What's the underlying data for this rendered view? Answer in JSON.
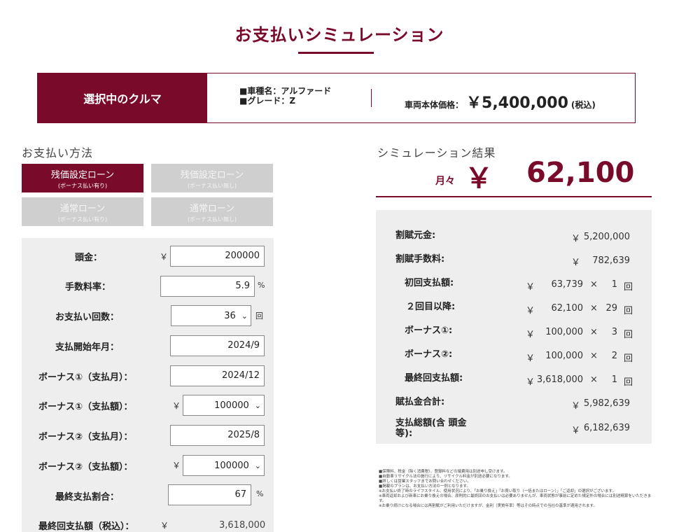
{
  "page": {
    "title": "お支払いシミュレーション"
  },
  "car": {
    "header": "選択中のクルマ",
    "model_line": "■車種名：アルファード",
    "grade_line": "■グレード：Z",
    "price_label": "車両本体価格：",
    "price_value": "￥5,400,000",
    "price_tax": "(税込)"
  },
  "payment_method": {
    "label": "お支払い方法",
    "options": [
      {
        "label": "残価設定ローン",
        "sub": "(ボーナス払い有り)",
        "active": true
      },
      {
        "label": "残価設定ローン",
        "sub": "(ボーナス払い無し)",
        "active": false
      },
      {
        "label": "通常ローン",
        "sub": "(ボーナス払い有り)",
        "active": false
      },
      {
        "label": "通常ローン",
        "sub": "(ボーナス払い無し)",
        "active": false
      }
    ]
  },
  "form": {
    "down_payment": {
      "label": "頭金：",
      "yen": "￥",
      "value": "200000"
    },
    "fee_rate": {
      "label": "手数料率：",
      "value": "5.9",
      "unit": "%"
    },
    "installments": {
      "label": "お支払い回数：",
      "value": "36",
      "unit": "回"
    },
    "start_month": {
      "label": "支払開始年月：",
      "value": "2024/9"
    },
    "bonus1_month": {
      "label": "ボーナス①（支払月）：",
      "value": "2024/12"
    },
    "bonus1_amount": {
      "label": "ボーナス①（支払額）：",
      "yen": "￥",
      "value": "100000"
    },
    "bonus2_month": {
      "label": "ボーナス②（支払月）：",
      "value": "2025/8"
    },
    "bonus2_amount": {
      "label": "ボーナス②（支払額）：",
      "yen": "￥",
      "value": "100000"
    },
    "final_ratio": {
      "label": "最終支払割合：",
      "value": "67",
      "unit": "%"
    },
    "final_amount": {
      "label": "最終回支払額（税込）：",
      "yen": "￥",
      "value": "3,618,000"
    }
  },
  "result": {
    "label": "シミュレーション結果",
    "monthly_label": "月々",
    "monthly_yen": "￥",
    "monthly_amount": "62,100",
    "rows": [
      {
        "label": "割賦元金:",
        "yen": "￥",
        "value": "5,200,000"
      },
      {
        "label": "割賦手数料:",
        "yen": "￥",
        "value": "782,639"
      },
      {
        "label": "初回支払額:",
        "yen": "￥",
        "value": "63,739",
        "x": "×",
        "count": "1",
        "unit": "回"
      },
      {
        "label": "２回目以降:",
        "yen": "￥",
        "value": "62,100",
        "x": "×",
        "count": "29",
        "unit": "回"
      },
      {
        "label": "ボーナス①:",
        "yen": "￥",
        "value": "100,000",
        "x": "×",
        "count": "3",
        "unit": "回"
      },
      {
        "label": "ボーナス②:",
        "yen": "￥",
        "value": "100,000",
        "x": "×",
        "count": "2",
        "unit": "回"
      },
      {
        "label": "最終回支払額:",
        "yen": "￥",
        "value": "3,618,000",
        "x": "×",
        "count": "1",
        "unit": "回"
      },
      {
        "label": "賦払金合計:",
        "yen": "￥",
        "value": "5,982,639"
      },
      {
        "label": "支払総額(含 頭金等):",
        "yen": "￥",
        "value": "6,182,639"
      }
    ]
  },
  "notes": [
    "■保険料、税金（除く消費税）、登録料などの諸費用は別途申し受けます。",
    "■自動車リサイクル法の施行により、リサイクル料金が別途必要になります。",
    "■詳しくは営業スタッフまでお問い合わせください。",
    "■掲載のプランは、お支払い方法の一例となります。",
    "※お支払い終了時のライフスタイル、使用状況により、「お乗り換え」「お買い取り（一括またはローン）」「ご返却」の選択がございます。",
    "※車両返却および新車にお乗り換えの場合、原則的に最終回のお支払いは必要ありませんが、車両状態が事前に定めた規定外の場合には別途精算をいただきます。",
    "※お乗り続けになる場合には再割賦がご利用いただけますが、金利（実質年率）等はその時点での当社の基準が適用されます。"
  ]
}
